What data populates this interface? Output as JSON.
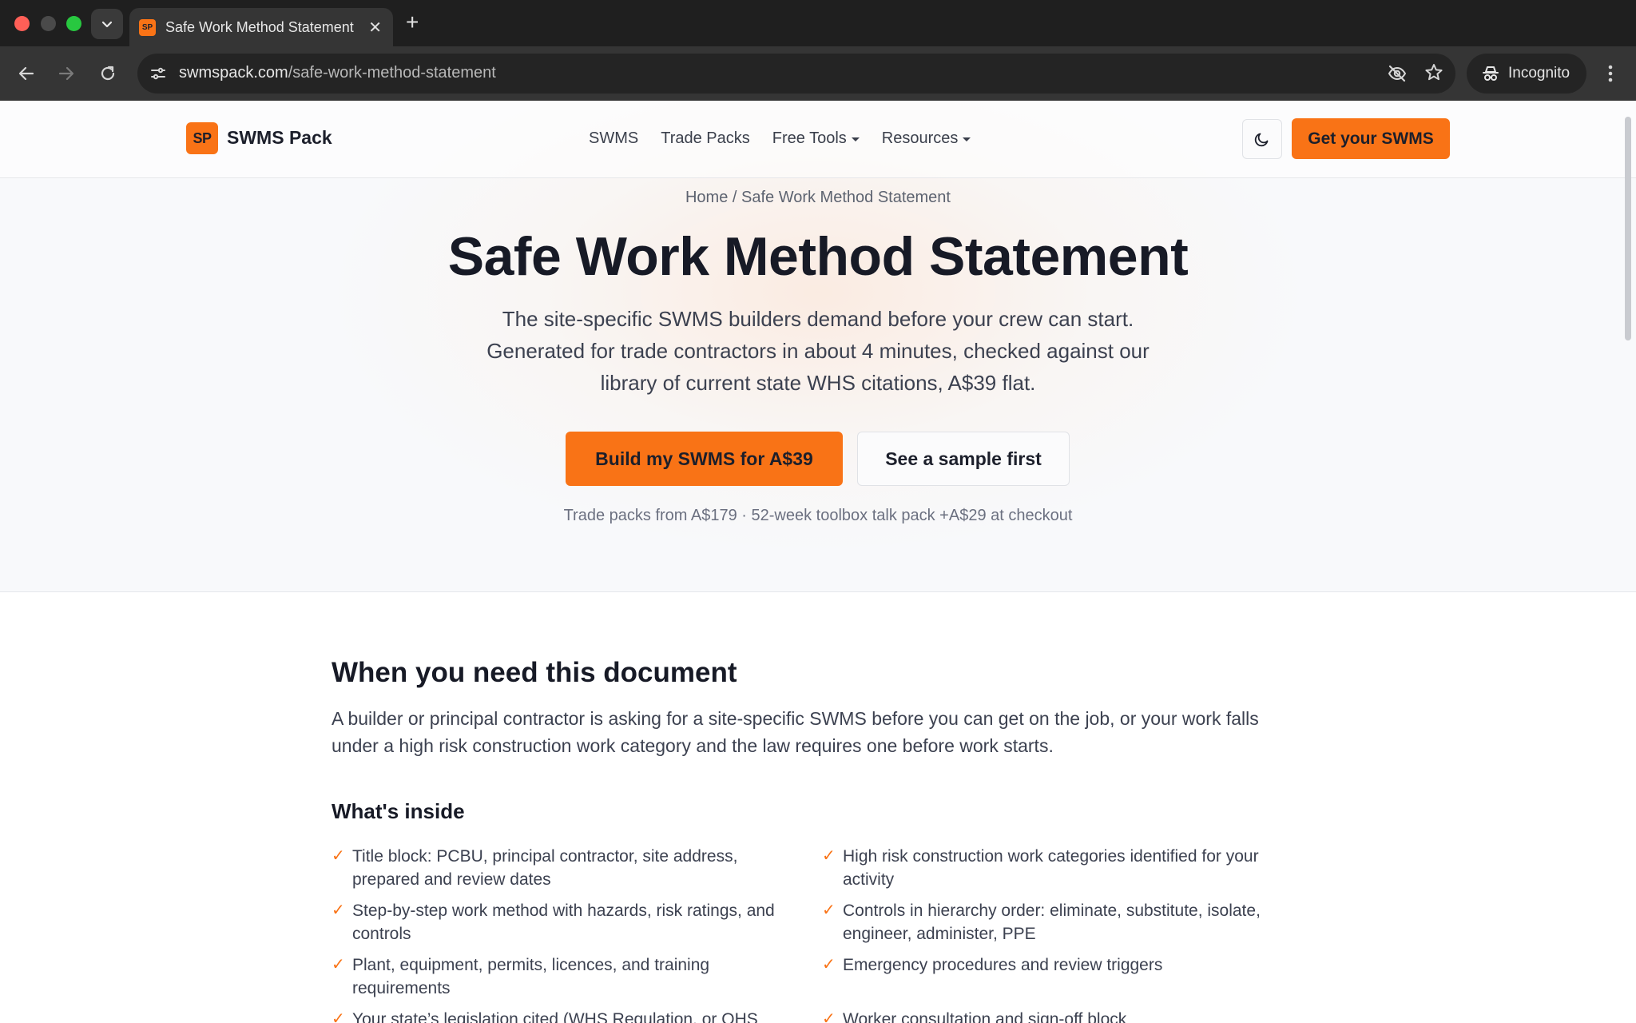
{
  "browser": {
    "tab_title": "Safe Work Method Statement",
    "favicon_text": "SP",
    "url_domain": "swmspack.com",
    "url_path": "/safe-work-method-statement",
    "incognito_label": "Incognito"
  },
  "header": {
    "logo_mark": "SP",
    "logo_text": "SWMS Pack",
    "nav": [
      {
        "label": "SWMS"
      },
      {
        "label": "Trade Packs"
      },
      {
        "label": "Free Tools"
      },
      {
        "label": "Resources"
      }
    ],
    "cta_label": "Get your SWMS"
  },
  "hero": {
    "breadcrumb": "Home / Safe Work Method Statement",
    "title": "Safe Work Method Statement",
    "lede": "The site-specific SWMS builders demand before your crew can start. Generated for trade contractors in about 4 minutes, checked against our library of current state WHS citations, A$39 flat.",
    "primary_button": "Build my SWMS for A$39",
    "secondary_button": "See a sample first",
    "note": "Trade packs from A$179 · 52-week toolbox talk pack +A$29 at checkout"
  },
  "content": {
    "section_title": "When you need this document",
    "section_text": "A builder or principal contractor is asking for a site-specific SWMS before you can get on the job, or your work falls under a high risk construction work category and the law requires one before work starts.",
    "inside_title": "What's inside",
    "check_mark": "✓",
    "items": [
      "Title block: PCBU, principal contractor, site address, prepared and review dates",
      "High risk construction work categories identified for your activity",
      "Step-by-step work method with hazards, risk ratings, and controls",
      "Controls in hierarchy order: eliminate, substitute, isolate, engineer, administer, PPE",
      "Plant, equipment, permits, licences, and training requirements",
      "Emergency procedures and review triggers",
      "Your state’s legislation cited (WHS Regulation, or OHS",
      "Worker consultation and sign-off block"
    ]
  },
  "colors": {
    "accent": "#f97316",
    "text": "#171a26"
  }
}
